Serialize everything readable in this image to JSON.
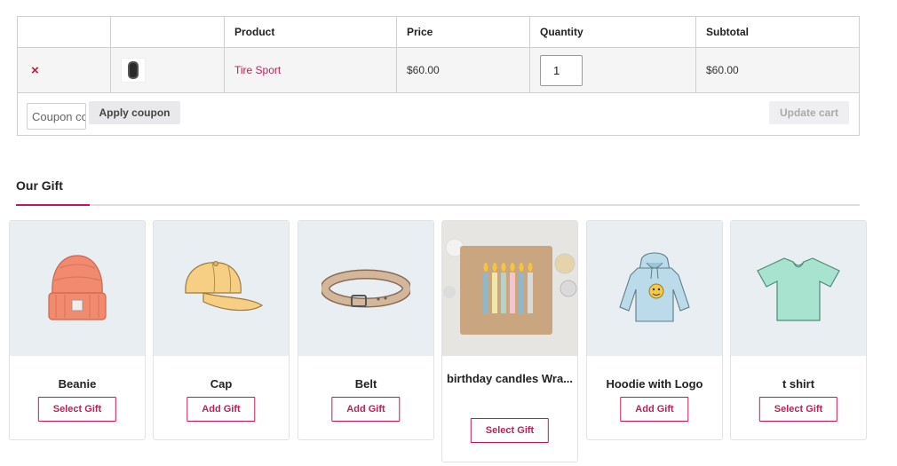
{
  "cart": {
    "headers": [
      "",
      "",
      "Product",
      "Price",
      "Quantity",
      "Subtotal"
    ],
    "item": {
      "remove_glyph": "×",
      "thumbnail_icon": "tire-icon",
      "product": "Tire Sport",
      "price": "$60.00",
      "quantity": "1",
      "subtotal": "$60.00"
    },
    "coupon_placeholder": "Coupon code",
    "apply_label": "Apply coupon",
    "update_label": "Update cart"
  },
  "gifts": {
    "title": "Our Gift",
    "accent_color": "#c2185b",
    "items": [
      {
        "name": "Beanie",
        "button": "Select Gift",
        "icon": "beanie-icon"
      },
      {
        "name": "Cap",
        "button": "Add Gift",
        "icon": "cap-icon"
      },
      {
        "name": "Belt",
        "button": "Add Gift",
        "icon": "belt-icon"
      },
      {
        "name": "birthday candles Wra...",
        "button": "Select Gift",
        "icon": "gift-box-candles-icon"
      },
      {
        "name": "Hoodie with Logo",
        "button": "Add Gift",
        "icon": "hoodie-icon"
      },
      {
        "name": "t shirt",
        "button": "Select Gift",
        "icon": "tshirt-icon"
      }
    ]
  }
}
